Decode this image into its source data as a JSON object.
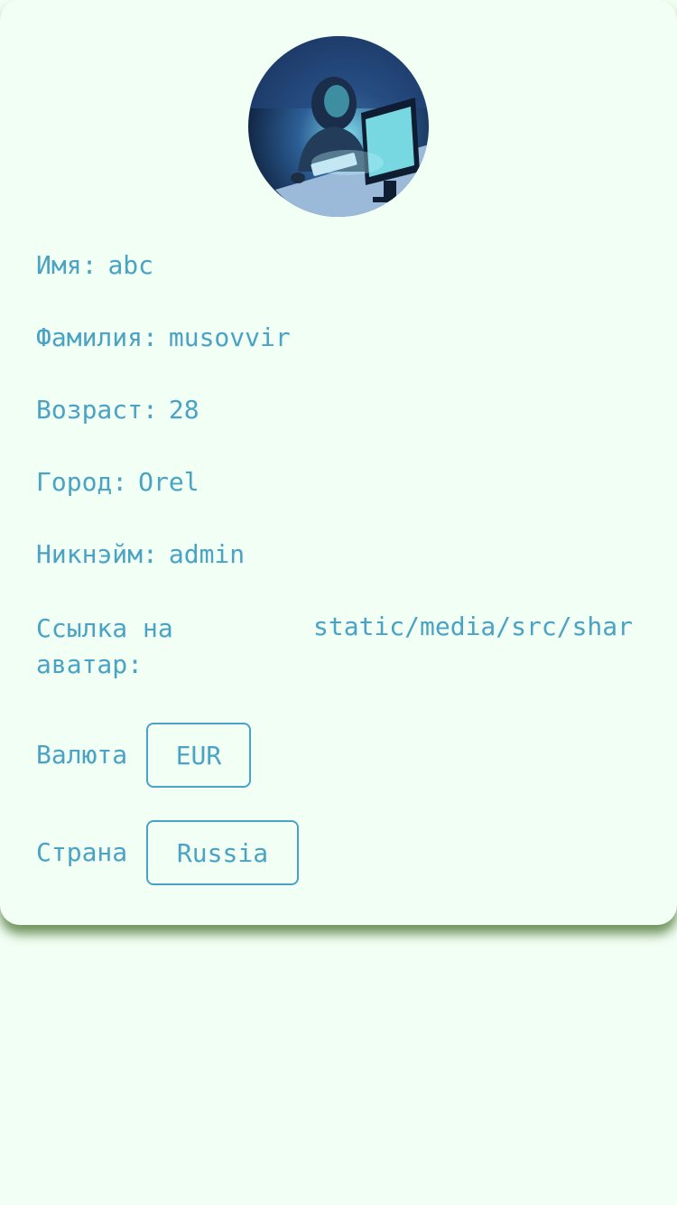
{
  "profile": {
    "fields": [
      {
        "label": "Имя:",
        "value": "abc"
      },
      {
        "label": "Фамилия:",
        "value": "musovvir"
      },
      {
        "label": "Возраст:",
        "value": "28"
      },
      {
        "label": "Город:",
        "value": "Orel"
      },
      {
        "label": "Никнэйм:",
        "value": "admin"
      }
    ],
    "avatar_link": {
      "label": "Ссылка на аватар:",
      "value": "static/media/src/shar"
    },
    "currency": {
      "label": "Валюта",
      "selected": "EUR"
    },
    "country": {
      "label": "Страна",
      "selected": "Russia"
    },
    "avatar_icon": "hacker-avatar-image"
  },
  "colors": {
    "background": "#f1fff4",
    "text": "#4aa3c4",
    "shadow": "#466e28"
  }
}
